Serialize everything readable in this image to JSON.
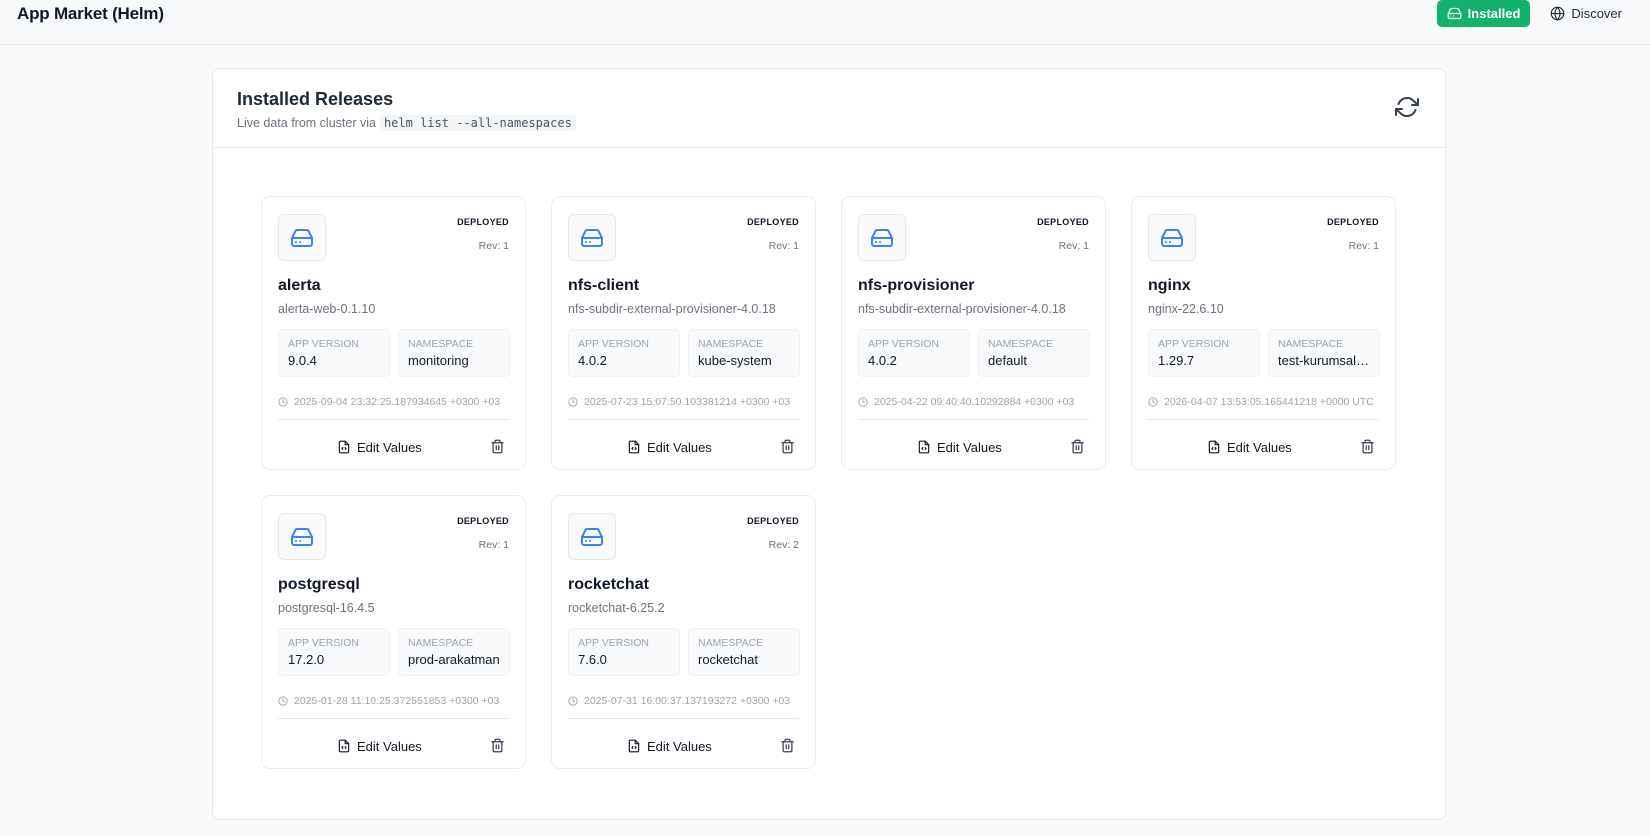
{
  "header": {
    "title": "App Market (Helm)",
    "nav": [
      {
        "label": "Installed",
        "icon": "hard-drive-icon",
        "active": true
      },
      {
        "label": "Discover",
        "icon": "globe-icon",
        "active": false
      }
    ],
    "accent_color": "#12b16d"
  },
  "panel": {
    "title": "Installed Releases",
    "subtitle_prefix": "Live data from cluster via",
    "subtitle_command": "helm list --all-namespaces",
    "refresh_icon": "refresh-icon"
  },
  "labels": {
    "app_version": "APP VERSION",
    "namespace": "NAMESPACE",
    "edit_values": "Edit Values"
  },
  "releases": [
    {
      "name": "alerta",
      "chart": "alerta-web-0.1.10",
      "status": "DEPLOYED",
      "revision": "Rev: 1",
      "app_version": "9.0.4",
      "namespace": "monitoring",
      "updated": "2025-09-04 23:32:25.187934645 +0300 +03"
    },
    {
      "name": "nfs-client",
      "chart": "nfs-subdir-external-provisioner-4.0.18",
      "status": "DEPLOYED",
      "revision": "Rev: 1",
      "app_version": "4.0.2",
      "namespace": "kube-system",
      "updated": "2025-07-23 15:07:50.103381214 +0300 +03"
    },
    {
      "name": "nfs-provisioner",
      "chart": "nfs-subdir-external-provisioner-4.0.18",
      "status": "DEPLOYED",
      "revision": "Rev: 1",
      "app_version": "4.0.2",
      "namespace": "default",
      "updated": "2025-04-22 09:40:40.10292884 +0300 +03"
    },
    {
      "name": "nginx",
      "chart": "nginx-22.6.10",
      "status": "DEPLOYED",
      "revision": "Rev: 1",
      "app_version": "1.29.7",
      "namespace": "test-kurumsal-portal",
      "updated": "2026-04-07 13:53:05.165441218 +0000 UTC"
    },
    {
      "name": "postgresql",
      "chart": "postgresql-16.4.5",
      "status": "DEPLOYED",
      "revision": "Rev: 1",
      "app_version": "17.2.0",
      "namespace": "prod-arakatman",
      "updated": "2025-01-28 11:10:25.372551853 +0300 +03"
    },
    {
      "name": "rocketchat",
      "chart": "rocketchat-6.25.2",
      "status": "DEPLOYED",
      "revision": "Rev: 2",
      "app_version": "7.6.0",
      "namespace": "rocketchat",
      "updated": "2025-07-31 16:00:37.137193272 +0300 +03"
    }
  ],
  "colors": {
    "icon_blue": "#3b82f6",
    "border": "#e5e7eb"
  }
}
